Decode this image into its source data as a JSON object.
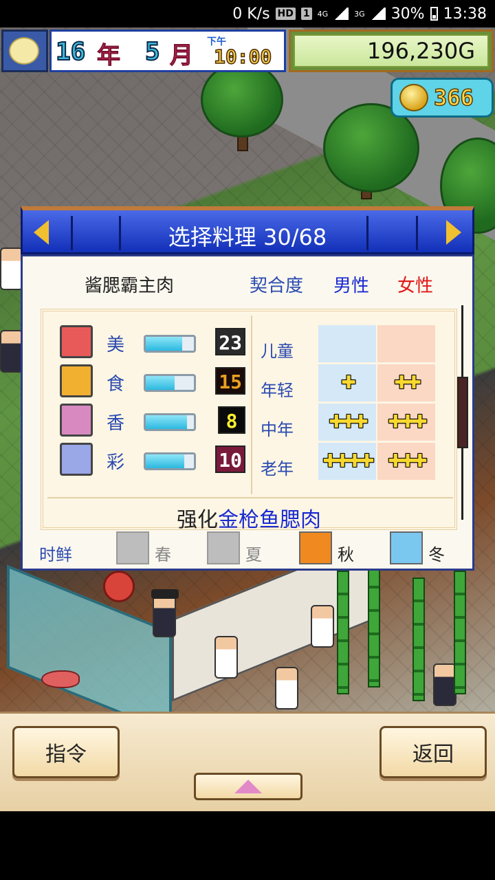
{
  "status_bar": {
    "network_speed": "0 K/s",
    "hd_badge": "HD",
    "sim_badge": "1",
    "net_4g": "4G",
    "net_3g": "3G",
    "battery": "30%",
    "time": "13:38"
  },
  "hud": {
    "year_num": "16",
    "year_unit": "年",
    "month_num": "5",
    "month_unit": "月",
    "ampm": "下午",
    "clock": "10:00",
    "money": "196,230G",
    "coins": "366"
  },
  "dialog": {
    "title": "选择料理 30/68",
    "dish_name": "酱腮霸主肉",
    "fit_label": "契合度",
    "male_label": "男性",
    "female_label": "女性",
    "stats": [
      {
        "label": "美",
        "value": "23",
        "level": 0.75,
        "value_color": "#ffffff",
        "value_bg": "#2a2a2a",
        "icon_color": "#e85a5a"
      },
      {
        "label": "食",
        "value": "15",
        "level": 0.6,
        "value_color": "#e8a020",
        "value_bg": "#1a0a0a",
        "icon_color": "#f2b030"
      },
      {
        "label": "香",
        "value": "8",
        "level": 0.85,
        "value_color": "#f8f030",
        "value_bg": "#0a0a0a",
        "icon_color": "#d88ac0"
      },
      {
        "label": "彩",
        "value": "10",
        "level": 0.8,
        "value_color": "#ffffff",
        "value_bg": "#7a1a3a",
        "icon_color": "#9aa8e8"
      }
    ],
    "ages": [
      {
        "label": "儿童",
        "male": "",
        "female": ""
      },
      {
        "label": "年轻",
        "male": "✚",
        "female": "✚✚"
      },
      {
        "label": "中年",
        "male": "✚✚✚",
        "female": "✚✚✚"
      },
      {
        "label": "老年",
        "male": "✚✚✚✚",
        "female": "✚✚✚"
      }
    ],
    "enhance_prefix": "强化",
    "enhance_target": "金枪鱼腮肉",
    "season_title": "时鲜",
    "seasons": [
      {
        "name": "春",
        "active": false
      },
      {
        "name": "夏",
        "active": false
      },
      {
        "name": "秋",
        "active": true,
        "icon_color": "#f08a20"
      },
      {
        "name": "冬",
        "active": true,
        "icon_color": "#7ac8f0"
      }
    ]
  },
  "bottom": {
    "command_label": "指令",
    "back_label": "返回"
  }
}
